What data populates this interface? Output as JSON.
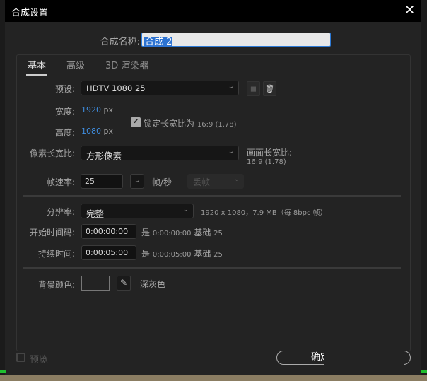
{
  "window": {
    "title": "合成设置"
  },
  "comp_name": {
    "label": "合成名称:",
    "value": "合成 2"
  },
  "tabs": [
    {
      "label": "基本",
      "active": true
    },
    {
      "label": "高级"
    },
    {
      "label": "3D 渲染器"
    }
  ],
  "preset": {
    "label": "预设:",
    "value": "HDTV 1080 25"
  },
  "width": {
    "label": "宽度:",
    "value": "1920",
    "unit": "px"
  },
  "height": {
    "label": "高度:",
    "value": "1080",
    "unit": "px"
  },
  "lock_aspect": {
    "label": "锁定长宽比为",
    "ratio": "16:9 (1.78)",
    "checked": true
  },
  "pixel_aspect": {
    "label": "像素长宽比:",
    "value": "方形像素"
  },
  "frame_aspect": {
    "label": "画面长宽比:",
    "value": "16:9 (1.78)"
  },
  "frame_rate": {
    "label": "帧速率:",
    "value": "25",
    "unit": "帧/秒",
    "drop_frame": "丢帧"
  },
  "resolution": {
    "label": "分辨率:",
    "value": "完整",
    "info": "1920 x 1080，7.9 MB（每 8bpc 帧）"
  },
  "start_timecode": {
    "label": "开始时间码:",
    "value": "0:00:00:00",
    "is": "是",
    "equiv": "0:00:00:00",
    "base_label": "基础",
    "base": "25"
  },
  "duration": {
    "label": "持续时间:",
    "value": "0:00:05:00",
    "is": "是",
    "equiv": "0:00:05:00",
    "base_label": "基础",
    "base": "25"
  },
  "background": {
    "label": "背景颜色:",
    "name": "深灰色",
    "color": "#232323"
  },
  "footer": {
    "preview": "预览",
    "ok": "确定"
  }
}
